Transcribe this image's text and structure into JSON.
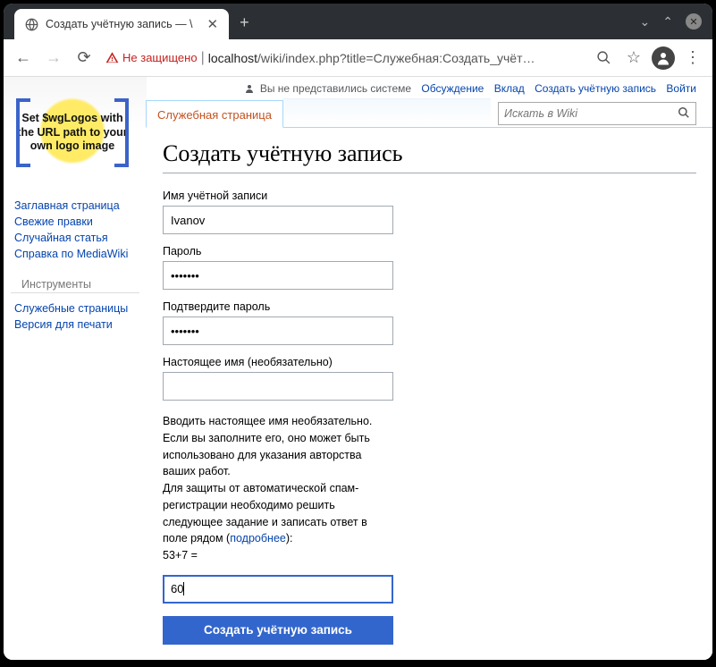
{
  "browser": {
    "tab_title": "Создать учётную запись — \\",
    "insecure_label": "Не защищено",
    "url_host": "localhost",
    "url_path": "/wiki/index.php?title=Служебная:Создать_учёт…"
  },
  "top_links": {
    "anon": "Вы не представились системе",
    "talk": "Обсуждение",
    "contrib": "Вклад",
    "create": "Создать учётную запись",
    "login": "Войти"
  },
  "logo_text": "Set $wgLogos with the URL path to your own logo image",
  "sidebar": {
    "nav": [
      "Заглавная страница",
      "Свежие правки",
      "Случайная статья",
      "Справка по MediaWiki"
    ],
    "tools_hdr": "Инструменты",
    "tools": [
      "Служебные страницы",
      "Версия для печати"
    ]
  },
  "page_tab": "Служебная страница",
  "search_placeholder": "Искать в Wiki",
  "heading": "Создать учётную запись",
  "form": {
    "username_label": "Имя учётной записи",
    "username_value": "Ivanov",
    "password_label": "Пароль",
    "password_value": "•••••••",
    "confirm_label": "Подтвердите пароль",
    "confirm_value": "•••••••",
    "realname_label": "Настоящее имя (необязательно)",
    "realname_value": "",
    "help1": "Вводить настоящее имя необязательно. Если вы заполните его, оно может быть использовано для указания авторства ваших работ.",
    "help2a": "Для защиты от автоматической спам-регистрации необходимо решить следующее задание и записать ответ в поле рядом (",
    "help2_link": "подробнее",
    "help2b": "):",
    "captcha_q": "53+7 =",
    "captcha_value": "60",
    "submit": "Создать учётную запись"
  }
}
